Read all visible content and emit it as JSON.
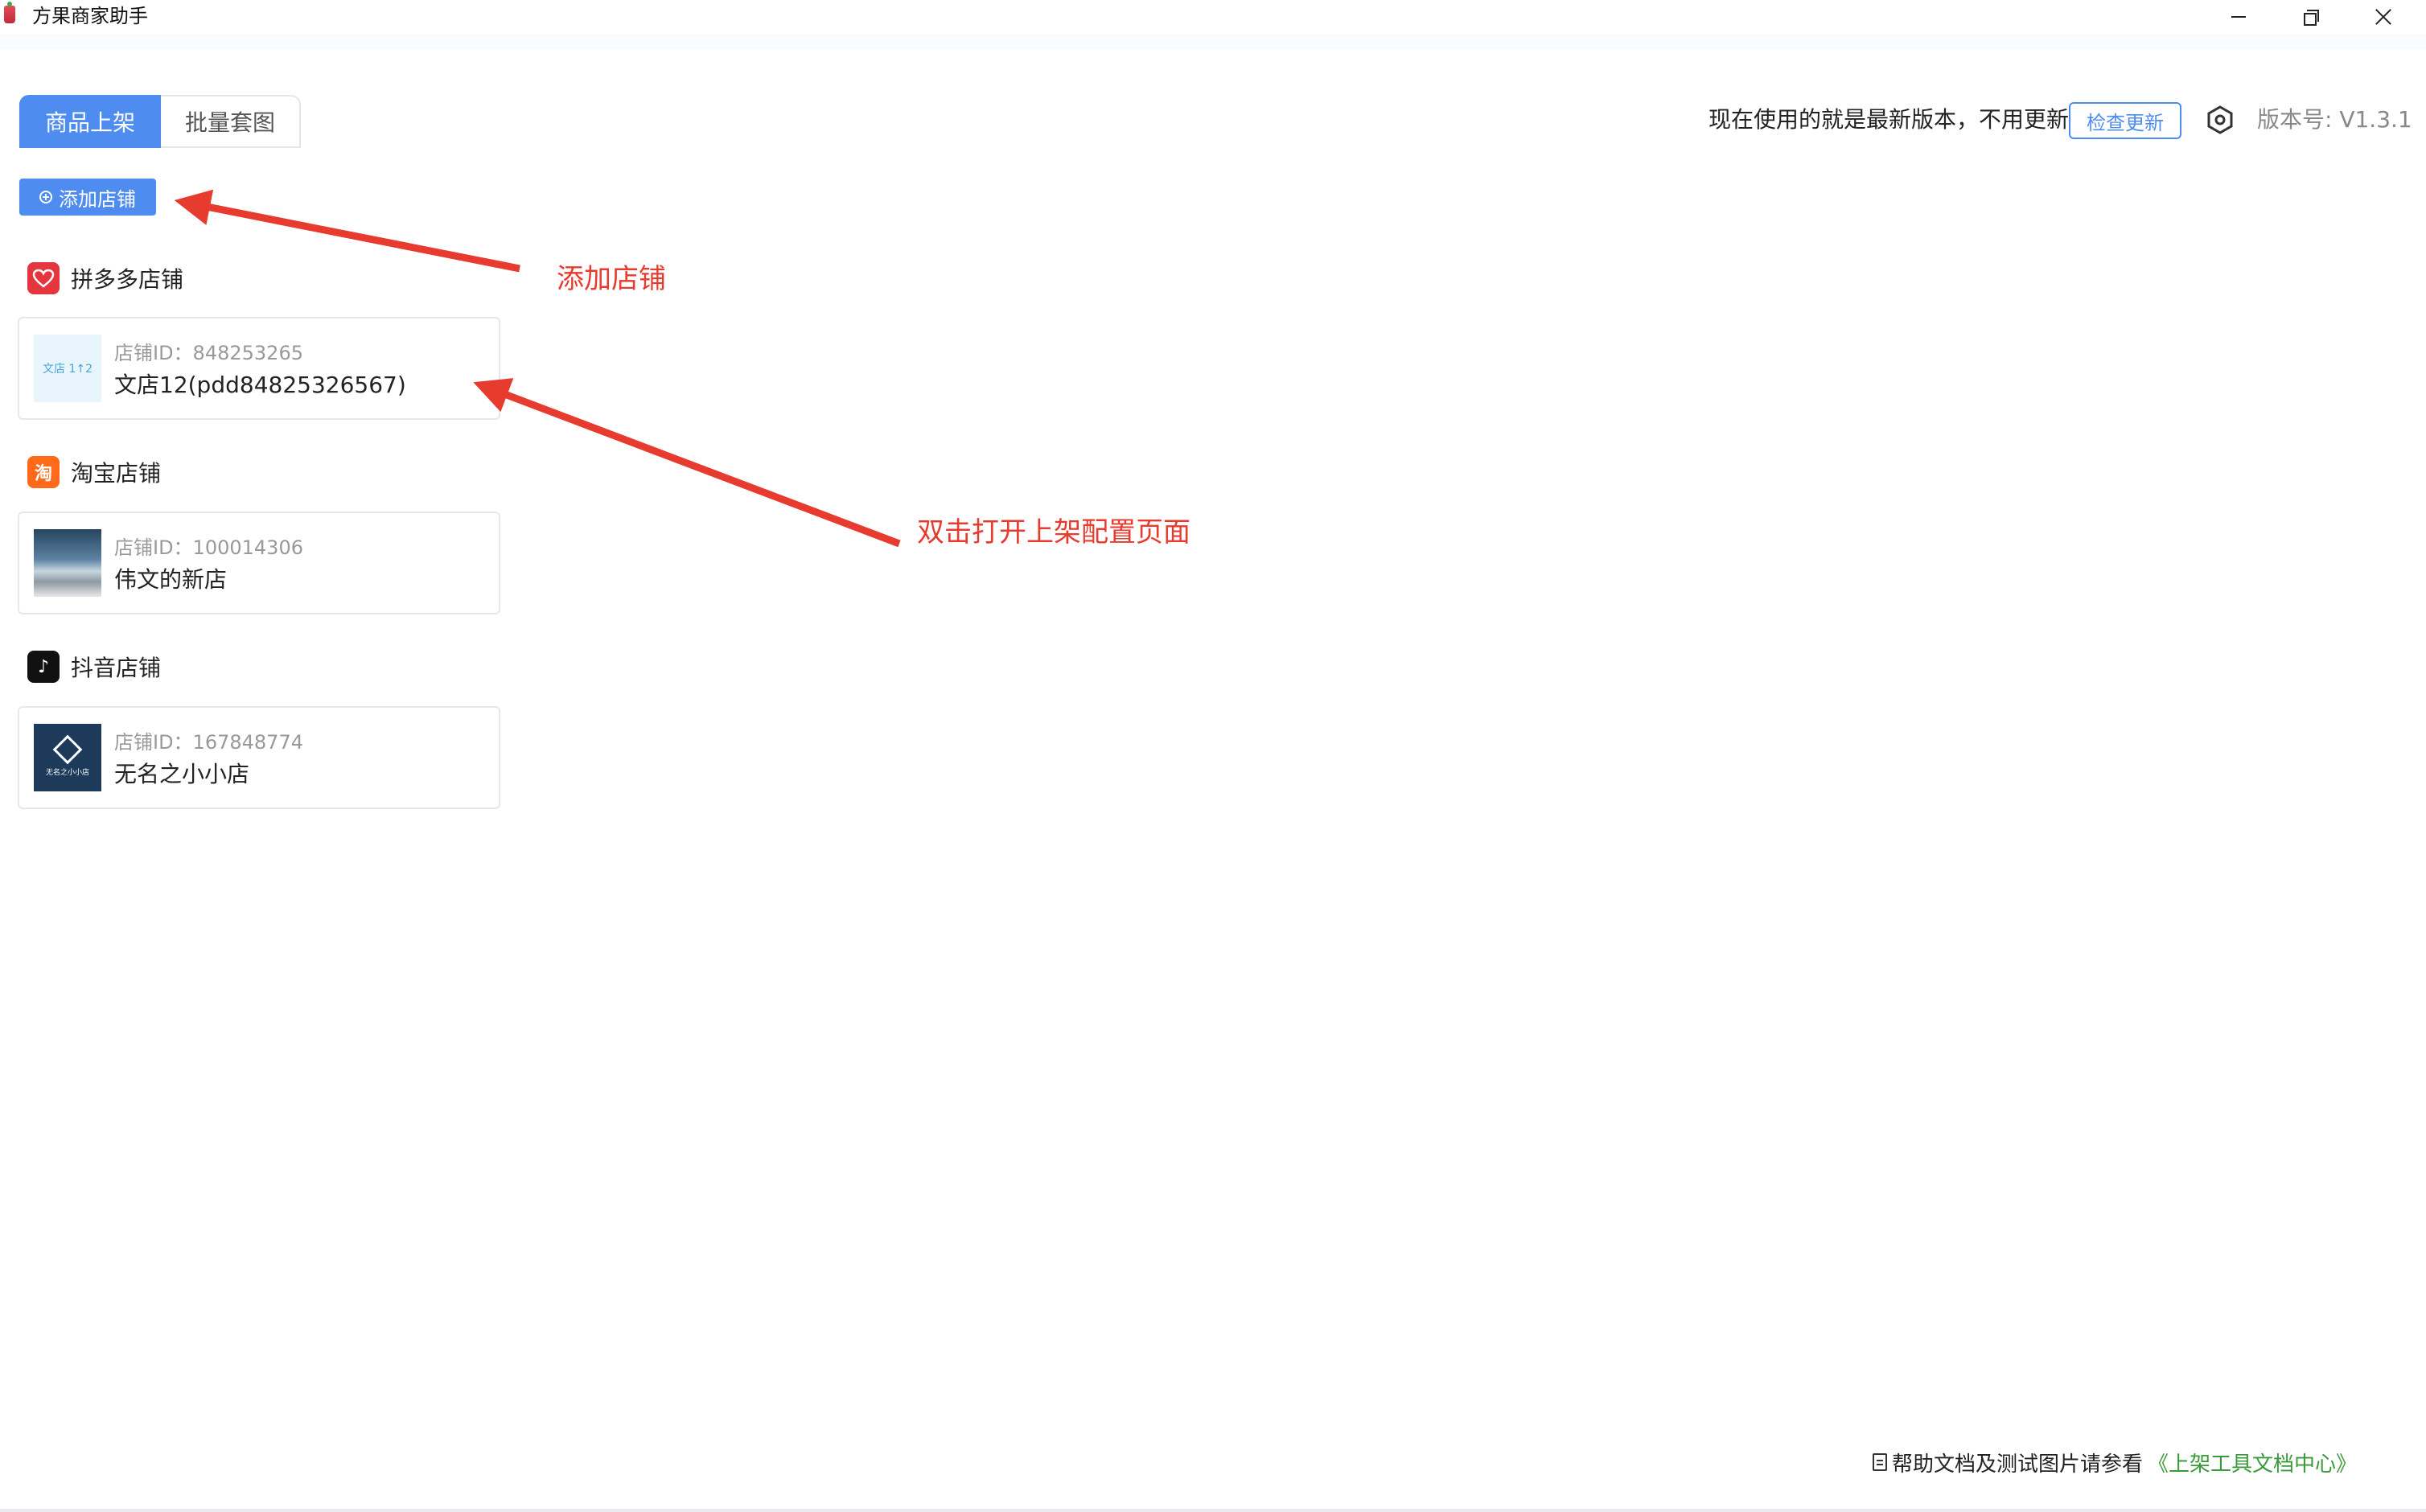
{
  "window": {
    "title": "方果商家助手"
  },
  "tabs": [
    {
      "label": "商品上架",
      "active": true
    },
    {
      "label": "批量套图",
      "active": false
    }
  ],
  "update": {
    "status_text": "现在使用的就是最新版本，不用更新",
    "check_button": "检查更新",
    "version_text": "版本号: V1.3.1"
  },
  "toolbar": {
    "add_shop_label": "添加店铺"
  },
  "sections": [
    {
      "label": "拼多多店铺",
      "icon": "pinduoduo-icon",
      "shops": [
        {
          "id_text": "店铺ID：848253265",
          "name": "文店12(pdd84825326567)",
          "thumb_text": "文店 1↑2"
        }
      ]
    },
    {
      "label": "淘宝店铺",
      "icon": "taobao-icon",
      "icon_glyph": "淘",
      "shops": [
        {
          "id_text": "店铺ID：100014306",
          "name": "伟文的新店"
        }
      ]
    },
    {
      "label": "抖音店铺",
      "icon": "douyin-icon",
      "icon_glyph": "♪",
      "shops": [
        {
          "id_text": "店铺ID：167848774",
          "name": "无名之小小店",
          "thumb_text": "无名之小小店"
        }
      ]
    }
  ],
  "annotations": {
    "add_shop": "添加店铺",
    "double_click": "双击打开上架配置页面"
  },
  "footer": {
    "text": "帮助文档及测试图片请参看",
    "link": "《上架工具文档中心》"
  },
  "colors": {
    "primary": "#4f8cf0",
    "annotation": "#e63b2e",
    "link": "#3a9a3a"
  }
}
